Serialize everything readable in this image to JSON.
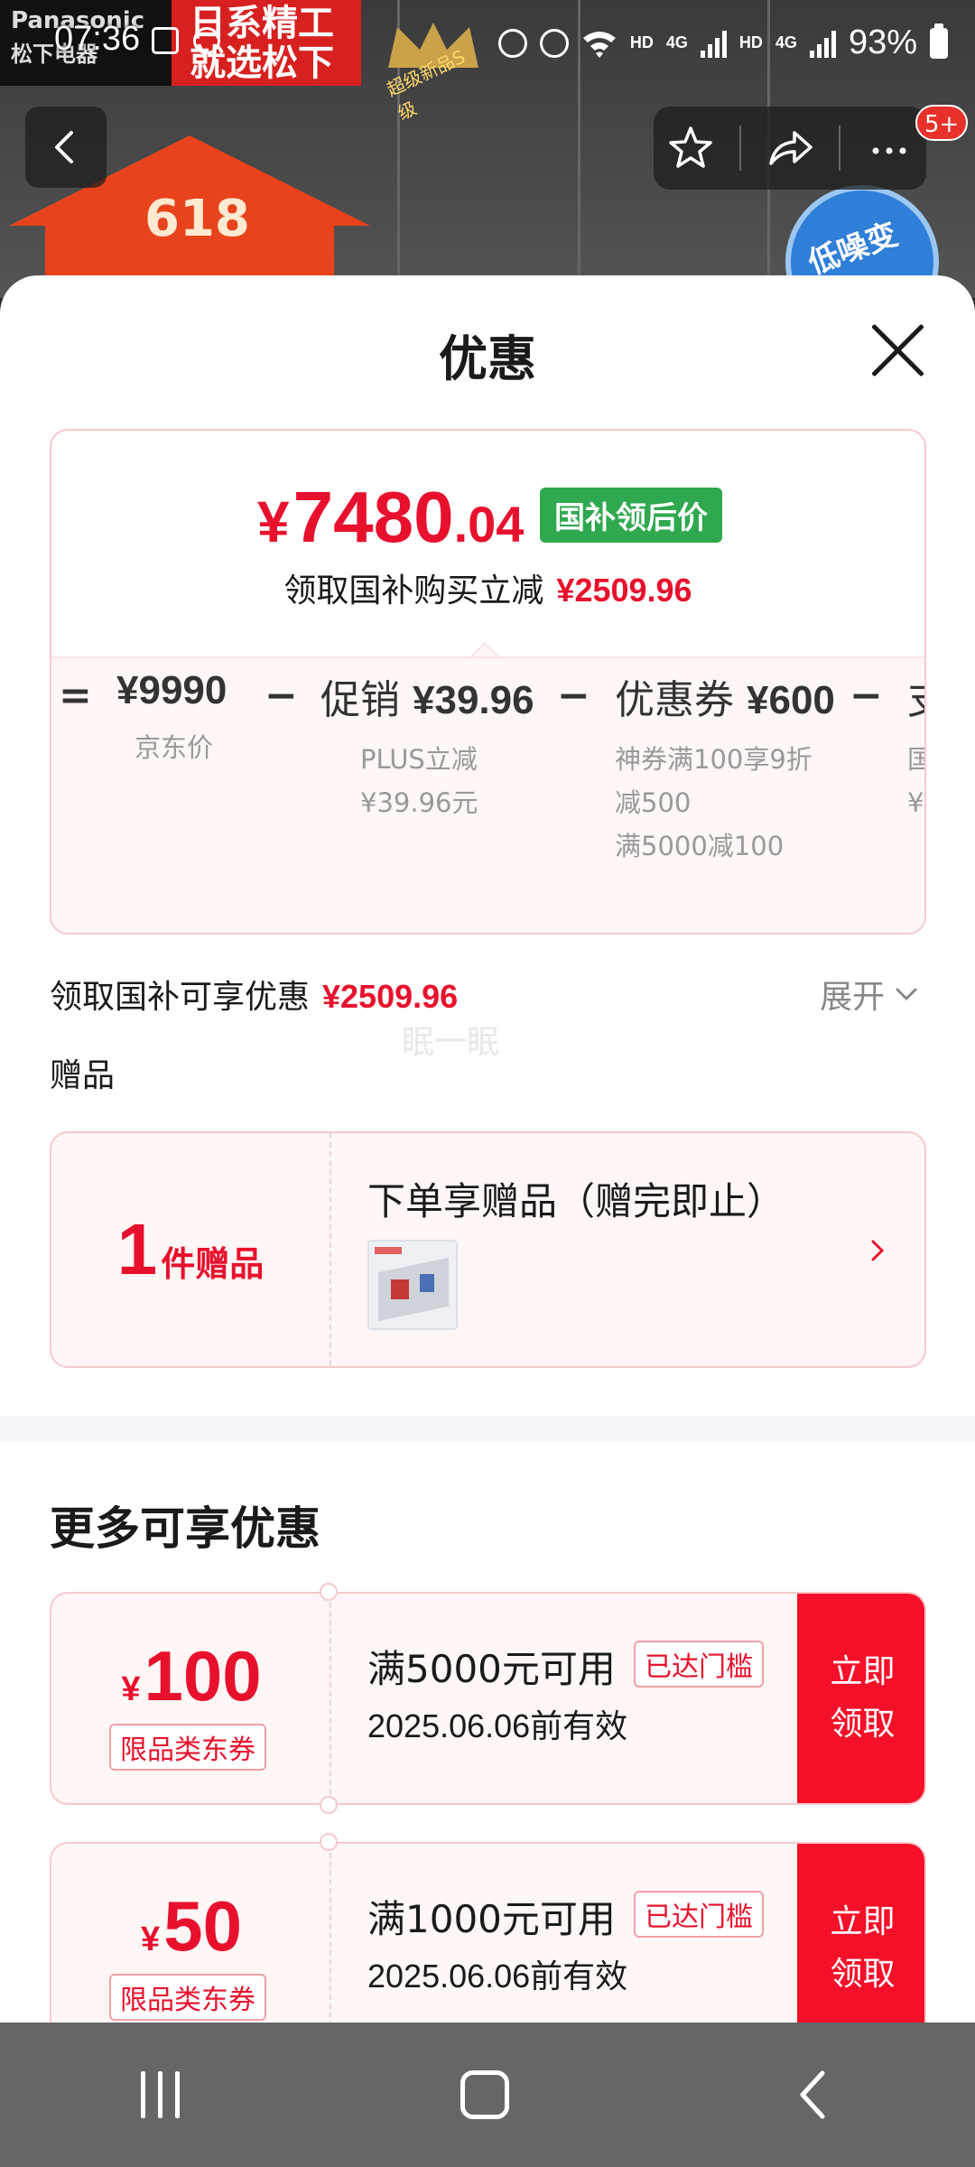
{
  "status_bar": {
    "time": "07:36",
    "hd1": "HD",
    "net1": "4G",
    "hd2": "HD",
    "net2": "4G",
    "battery": "93%"
  },
  "background": {
    "brand_line1": "Panasonic",
    "brand_line2": "松下电器",
    "banner_line1": "日系精工",
    "banner_line2": "就选松下",
    "promo_number": "618",
    "badge_text": "低噪变频",
    "crown_text": "超级新品S级",
    "notification_count": "5+"
  },
  "sheet": {
    "title": "优惠",
    "price": {
      "currency": "¥",
      "integer": "7480",
      "decimal": ".04",
      "tag": "国补领后价",
      "subtitle_text": "领取国补购买立减",
      "subtitle_amount": "¥2509.96"
    },
    "breakdown": [
      {
        "op": "=",
        "label": "",
        "value": "¥9990",
        "desc": [
          "京东价"
        ]
      },
      {
        "op": "−",
        "label": "促销",
        "value": "¥39.96",
        "desc": [
          "PLUS立减",
          "¥39.96元"
        ]
      },
      {
        "op": "−",
        "label": "优惠券",
        "value": "¥600",
        "desc": [
          "神券满100享9折",
          "减500",
          "满5000减100"
        ]
      },
      {
        "op": "−",
        "label": "支",
        "value": "",
        "desc": [
          "国",
          "¥"
        ]
      }
    ],
    "benefit_text": "领取国补可享优惠",
    "benefit_amount": "¥2509.96",
    "expand_label": "展开",
    "watermark": "眠一眠",
    "gifts_label": "赠品",
    "gift": {
      "count": "1",
      "count_label": "件赠品",
      "title": "下单享赠品（赠完即止）"
    },
    "more_title": "更多可享优惠",
    "coupons": [
      {
        "currency": "¥",
        "amount": "100",
        "type": "限品类东券",
        "condition": "满5000元可用",
        "status": "已达门槛",
        "validity": "2025.06.06前有效",
        "claim_line1": "立即",
        "claim_line2": "领取"
      },
      {
        "currency": "¥",
        "amount": "50",
        "type": "限品类东券",
        "condition": "满1000元可用",
        "status": "已达门槛",
        "validity": "2025.06.06前有效",
        "claim_line1": "立即",
        "claim_line2": "领取"
      }
    ]
  },
  "icons": {
    "back": "back-arrow-icon",
    "favorite": "star-icon",
    "share": "share-icon",
    "more": "more-dots-icon",
    "close": "close-icon",
    "expand": "chevron-down-icon",
    "gift_arrow": "chevron-right-icon"
  },
  "colors": {
    "accent_red": "#e8112d",
    "claim_red": "#f5102a",
    "tag_green": "#2fa84f"
  }
}
